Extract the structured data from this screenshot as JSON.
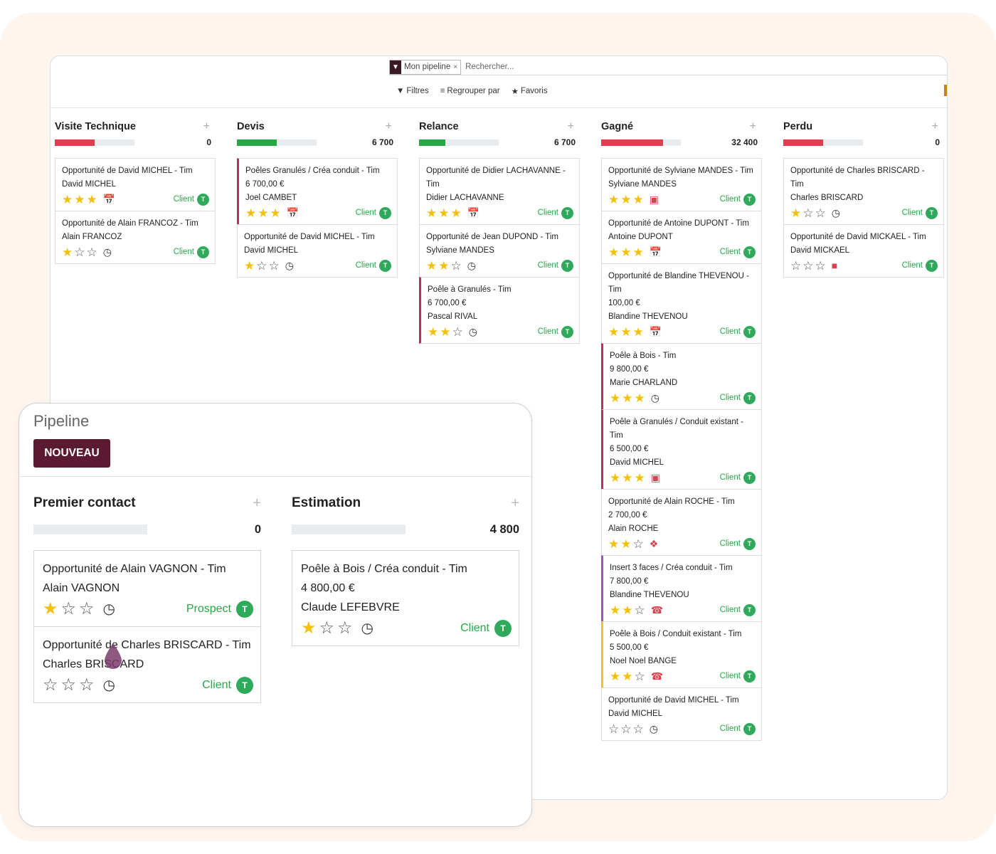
{
  "search": {
    "facet_label": "Mon pipeline",
    "placeholder": "Rechercher..."
  },
  "filters": {
    "filtres": "Filtres",
    "regrouper": "Regrouper par",
    "favoris": "Favoris"
  },
  "colors": {
    "accent": "#5b1a32",
    "green": "#28a745",
    "red": "#d9414f",
    "pink": "#d0245d",
    "purple": "#9b59b6",
    "yellow": "#f0c419"
  },
  "back_columns": [
    {
      "title": "Visite Technique",
      "total": "0",
      "bar_fill": 0.5,
      "bar_color": "#d9414f",
      "cards": [
        {
          "title": "Opportunité de David MICHEL - Tim",
          "lines": [
            "David MICHEL"
          ],
          "stars": 3,
          "activity": "calendar-icon",
          "tag": "Client",
          "avatar": "T",
          "border": ""
        },
        {
          "title": "Opportunité de Alain FRANCOZ - Tim",
          "lines": [
            "Alain FRANCOZ"
          ],
          "stars": 1,
          "activity": "clock-icon",
          "tag": "Client",
          "avatar": "T",
          "border": ""
        }
      ]
    },
    {
      "title": "Devis",
      "total": "6 700",
      "bar_fill": 0.5,
      "bar_color": "#28a745",
      "cards": [
        {
          "title": "Poêles Granulés / Créa conduit - Tim",
          "lines": [
            "6 700,00 €",
            "Joel CAMBET"
          ],
          "stars": 3,
          "activity": "calendar-green-icon",
          "tag": "Client",
          "avatar": "T",
          "border": "pink"
        },
        {
          "title": "Opportunité de David MICHEL - Tim",
          "lines": [
            "David MICHEL"
          ],
          "stars": 1,
          "activity": "clock-icon",
          "tag": "Client",
          "avatar": "T",
          "border": ""
        }
      ]
    },
    {
      "title": "Relance",
      "total": "6 700",
      "bar_fill": 0.33,
      "bar_color": "#28a745",
      "cards": [
        {
          "title": "Opportunité de Didier LACHAVANNE - Tim",
          "lines": [
            "Didier LACHAVANNE"
          ],
          "stars": 3,
          "activity": "calendar-green-icon",
          "tag": "Client",
          "avatar": "T",
          "border": ""
        },
        {
          "title": "Opportunité de Jean DUPOND - Tim",
          "lines": [
            "Sylviane MANDES"
          ],
          "stars": 2,
          "activity": "clock-icon",
          "tag": "Client",
          "avatar": "T",
          "border": ""
        },
        {
          "title": "Poêle à Granulés - Tim",
          "lines": [
            "6 700,00 €",
            "Pascal RIVAL"
          ],
          "stars": 2,
          "activity": "clock-icon",
          "tag": "Client",
          "avatar": "T",
          "border": "pink"
        }
      ]
    },
    {
      "title": "Gagné",
      "total": "32 400",
      "bar_fill": 0.78,
      "bar_color": "#d9414f",
      "cards": [
        {
          "title": "Opportunité de Sylviane MANDES - Tim",
          "lines": [
            "Sylviane MANDES"
          ],
          "stars": 3,
          "activity": "money-icon",
          "tag": "Client",
          "avatar": "T",
          "border": ""
        },
        {
          "title": "Opportunité de Antoine DUPONT - Tim",
          "lines": [
            "Antoine DUPONT"
          ],
          "stars": 3,
          "activity": "calendar-icon",
          "tag": "Client",
          "avatar": "T",
          "border": ""
        },
        {
          "title": "Opportunité de Blandine THEVENOU - Tim",
          "lines": [
            "100,00 €",
            "Blandine THEVENOU"
          ],
          "stars": 3,
          "activity": "calendar-icon",
          "tag": "Client",
          "avatar": "T",
          "border": ""
        },
        {
          "title": "Poêle à Bois - Tim",
          "lines": [
            "9 800,00 €",
            "Marie CHARLAND"
          ],
          "stars": 3,
          "activity": "clock-icon",
          "tag": "Client",
          "avatar": "T",
          "border": "pink"
        },
        {
          "title": "Poêle à Granulés / Conduit existant - Tim",
          "lines": [
            "6 500,00 €",
            "David MICHEL"
          ],
          "stars": 3,
          "activity": "money-icon",
          "tag": "Client",
          "avatar": "T",
          "border": "pink"
        },
        {
          "title": "Opportunité de Alain ROCHE - Tim",
          "lines": [
            "2 700,00 €",
            "Alain ROCHE"
          ],
          "stars": 2,
          "activity": "tag-icon",
          "tag": "Client",
          "avatar": "T",
          "border": ""
        },
        {
          "title": "Insert 3 faces / Créa conduit - Tim",
          "lines": [
            "7 800,00 €",
            "Blandine THEVENOU"
          ],
          "stars": 2,
          "activity": "phone-icon",
          "tag": "Client",
          "avatar": "T",
          "border": "purple"
        },
        {
          "title": "Poêle à Bois / Conduit existant - Tim",
          "lines": [
            "5 500,00 €",
            "Noel Noel BANGE"
          ],
          "stars": 2,
          "activity": "phone-icon",
          "tag": "Client",
          "avatar": "T",
          "border": "yellow"
        },
        {
          "title": "Opportunité de David MICHEL - Tim",
          "lines": [
            "David MICHEL"
          ],
          "stars": 0,
          "activity": "clock-icon",
          "tag": "Client",
          "avatar": "T",
          "border": ""
        }
      ]
    },
    {
      "title": "Perdu",
      "total": "0",
      "bar_fill": 0.5,
      "bar_color": "#d9414f",
      "cards": [
        {
          "title": "Opportunité de Charles BRISCARD - Tim",
          "lines": [
            "Charles BRISCARD"
          ],
          "stars": 1,
          "activity": "clock-icon",
          "tag": "Client",
          "avatar": "T",
          "border": ""
        },
        {
          "title": "Opportunité de David MICKAEL - Tim",
          "lines": [
            "David MICKAEL"
          ],
          "stars": 0,
          "activity": "gift-icon",
          "tag": "Client",
          "avatar": "T",
          "border": ""
        }
      ]
    }
  ],
  "front": {
    "title": "Pipeline",
    "new_button": "NOUVEAU",
    "columns": [
      {
        "title": "Premier contact",
        "total": "0",
        "bar_fill": 0,
        "bar_color": "#28a745",
        "cards": [
          {
            "title": "Opportunité de Alain VAGNON - Tim",
            "lines": [
              "Alain VAGNON"
            ],
            "stars": 1,
            "activity": "clock-icon",
            "tag": "Prospect",
            "avatar": "T",
            "border": ""
          },
          {
            "title": "Opportunité de Charles BRISCARD - Tim",
            "lines": [
              "Charles BRISCARD"
            ],
            "stars": 0,
            "activity": "clock-icon",
            "tag": "Client",
            "avatar": "T",
            "border": ""
          }
        ]
      },
      {
        "title": "Estimation",
        "total": "4 800",
        "bar_fill": 0,
        "bar_color": "#28a745",
        "cards": [
          {
            "title": "Poêle à Bois / Créa conduit - Tim",
            "lines": [
              "4 800,00 €",
              "Claude LEFEBVRE"
            ],
            "stars": 1,
            "activity": "clock-icon",
            "tag": "Client",
            "avatar": "T",
            "border": "pink"
          }
        ]
      }
    ]
  }
}
